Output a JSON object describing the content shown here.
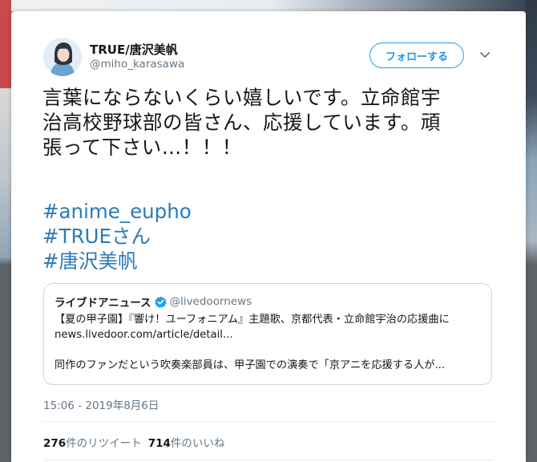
{
  "colors": {
    "link": "#2b7bb9",
    "follow_accent": "#1da1f2",
    "secondary_text": "#657786",
    "primary_text": "#14171a",
    "verified_badge": "#1da1f2"
  },
  "author": {
    "name": "TRUE/唐沢美帆",
    "handle": "@miho_karasawa",
    "avatar_icon": "profile-photo"
  },
  "follow_button": {
    "label": "フォローする"
  },
  "menu": {
    "icon": "chevron-down-icon"
  },
  "tweet": {
    "lines": [
      "言葉にならないくらい嬉しいです。立命館宇",
      "治高校野球部の皆さん、応援しています。頑",
      "張って下さい…！！！"
    ],
    "hashtags": [
      "#anime_eupho",
      "#TRUEさん",
      "#唐沢美帆"
    ]
  },
  "quoted_tweet": {
    "name": "ライブドアニュース",
    "verified_icon": "verified-badge-icon",
    "handle": "@livedoornews",
    "lines": [
      "【夏の甲子園】『響け！ユーフォニアム』主題歌、京都代表・立命館宇治の応援曲に",
      "news.livedoor.com/article/detail...",
      "同作のファンだという吹奏楽部員は、甲子園での演奏で「京アニを応援する人が..."
    ]
  },
  "timestamp": "15:06 - 2019年8月6日",
  "stats": {
    "retweets_count": "276",
    "retweets_label": "件のリツイート",
    "likes_count": "714",
    "likes_label": "件のいいね"
  }
}
